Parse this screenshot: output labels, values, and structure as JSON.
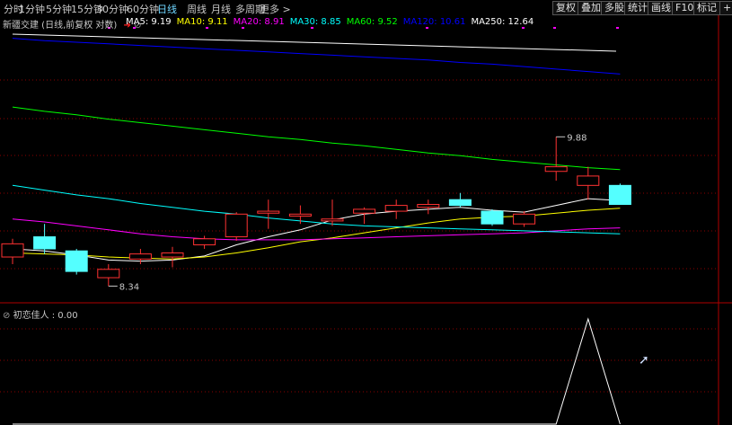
{
  "toolbar": {
    "timeframes": [
      "分时",
      "1分钟",
      "5分钟",
      "15分钟",
      "30分钟",
      "60分钟",
      "日线",
      "周线",
      "月线",
      "多周期",
      "更多 >"
    ],
    "active_timeframe": "日线",
    "right_buttons": [
      "复权",
      "叠加",
      "多股",
      "统计",
      "画线",
      "F10",
      "标记",
      "+自"
    ]
  },
  "main_panel": {
    "stock_title": "新疆交建 (日线,前复权 对数)",
    "ma_legend": [
      {
        "label": "MA5: 9.19",
        "color": "#ffffff"
      },
      {
        "label": "MA10: 9.11",
        "color": "#ffff00"
      },
      {
        "label": "MA20: 8.91",
        "color": "#ff00ff"
      },
      {
        "label": "MA30: 8.85",
        "color": "#00ffff"
      },
      {
        "label": "MA60: 9.52",
        "color": "#00ff00"
      },
      {
        "label": "MA120: 10.61",
        "color": "#0000ff"
      },
      {
        "label": "MA250: 12.64",
        "color": "#ffffff"
      }
    ],
    "high_label": "9.88",
    "low_label": "8.34"
  },
  "sub_panel": {
    "indicator_label": "初恋佳人 : 0.00"
  },
  "colors": {
    "up": "#ff3232",
    "down": "#54ffff",
    "grid": "#8b0000",
    "axis": "#b00000"
  },
  "chart_data": [
    {
      "type": "candlestick",
      "title": "新疆交建 (日线,前复权 对数)",
      "candles": [
        {
          "open": 8.62,
          "close": 8.75,
          "high": 8.8,
          "low": 8.55
        },
        {
          "open": 8.82,
          "close": 8.7,
          "high": 8.95,
          "low": 8.65
        },
        {
          "open": 8.68,
          "close": 8.48,
          "high": 8.7,
          "low": 8.45
        },
        {
          "open": 8.42,
          "close": 8.5,
          "high": 8.55,
          "low": 8.34
        },
        {
          "open": 8.6,
          "close": 8.65,
          "high": 8.7,
          "low": 8.55
        },
        {
          "open": 8.62,
          "close": 8.66,
          "high": 8.72,
          "low": 8.52
        },
        {
          "open": 8.74,
          "close": 8.8,
          "high": 8.83,
          "low": 8.7
        },
        {
          "open": 8.82,
          "close": 9.05,
          "high": 9.07,
          "low": 8.78
        },
        {
          "open": 9.06,
          "close": 9.08,
          "high": 9.2,
          "low": 8.9
        },
        {
          "open": 9.03,
          "close": 9.05,
          "high": 9.14,
          "low": 8.95
        },
        {
          "open": 8.98,
          "close": 9.0,
          "high": 9.2,
          "low": 8.93
        },
        {
          "open": 9.06,
          "close": 9.1,
          "high": 9.12,
          "low": 8.95
        },
        {
          "open": 9.08,
          "close": 9.14,
          "high": 9.2,
          "low": 9.0
        },
        {
          "open": 9.12,
          "close": 9.15,
          "high": 9.2,
          "low": 9.05
        },
        {
          "open": 9.2,
          "close": 9.14,
          "high": 9.27,
          "low": 9.12
        },
        {
          "open": 9.08,
          "close": 8.95,
          "high": 9.1,
          "low": 8.93
        },
        {
          "open": 8.95,
          "close": 9.05,
          "high": 9.08,
          "low": 8.92
        },
        {
          "open": 9.5,
          "close": 9.55,
          "high": 9.88,
          "low": 9.4
        },
        {
          "open": 9.35,
          "close": 9.45,
          "high": 9.55,
          "low": 9.2
        },
        {
          "open": 9.35,
          "close": 9.15,
          "high": 9.37,
          "low": 9.15
        }
      ],
      "ylim": [
        8.2,
        11.0
      ],
      "moving_averages": [
        {
          "name": "MA5",
          "color": "#ffffff",
          "values": [
            8.7,
            8.68,
            8.64,
            8.59,
            8.58,
            8.59,
            8.63,
            8.74,
            8.82,
            8.89,
            8.99,
            9.05,
            9.08,
            9.1,
            9.12,
            9.09,
            9.07,
            9.14,
            9.21,
            9.19
          ]
        },
        {
          "name": "MA10",
          "color": "#ffff00",
          "values": [
            8.66,
            8.65,
            8.64,
            8.62,
            8.61,
            8.6,
            8.62,
            8.66,
            8.71,
            8.77,
            8.81,
            8.86,
            8.91,
            8.96,
            9.0,
            9.02,
            9.03,
            9.06,
            9.09,
            9.11
          ]
        },
        {
          "name": "MA20",
          "color": "#ff00ff",
          "values": [
            9.0,
            8.97,
            8.93,
            8.89,
            8.85,
            8.82,
            8.8,
            8.79,
            8.79,
            8.79,
            8.8,
            8.81,
            8.82,
            8.83,
            8.84,
            8.85,
            8.86,
            8.88,
            8.9,
            8.91
          ]
        },
        {
          "name": "MA30",
          "color": "#00ffff",
          "values": [
            9.35,
            9.3,
            9.25,
            9.21,
            9.16,
            9.12,
            9.08,
            9.05,
            9.01,
            8.98,
            8.95,
            8.93,
            8.92,
            8.91,
            8.9,
            8.89,
            8.88,
            8.87,
            8.86,
            8.85
          ]
        },
        {
          "name": "MA60",
          "color": "#00ff00",
          "values": [
            10.22,
            10.17,
            10.13,
            10.08,
            10.04,
            10.0,
            9.96,
            9.92,
            9.88,
            9.85,
            9.81,
            9.78,
            9.74,
            9.7,
            9.67,
            9.63,
            9.6,
            9.57,
            9.54,
            9.52
          ]
        },
        {
          "name": "MA120",
          "color": "#0000ff",
          "values": [
            11.05,
            11.02,
            11.0,
            10.98,
            10.96,
            10.94,
            10.92,
            10.9,
            10.88,
            10.86,
            10.84,
            10.82,
            10.8,
            10.78,
            10.75,
            10.73,
            10.7,
            10.67,
            10.64,
            10.61
          ]
        }
      ]
    },
    {
      "type": "line",
      "title": "初恋佳人 : 0.00",
      "values": [
        0,
        0,
        0,
        0,
        0,
        0,
        0,
        0,
        0,
        0,
        0,
        0,
        0,
        0,
        0,
        0,
        0,
        0,
        1,
        0
      ],
      "ylim": [
        0,
        1
      ]
    }
  ]
}
